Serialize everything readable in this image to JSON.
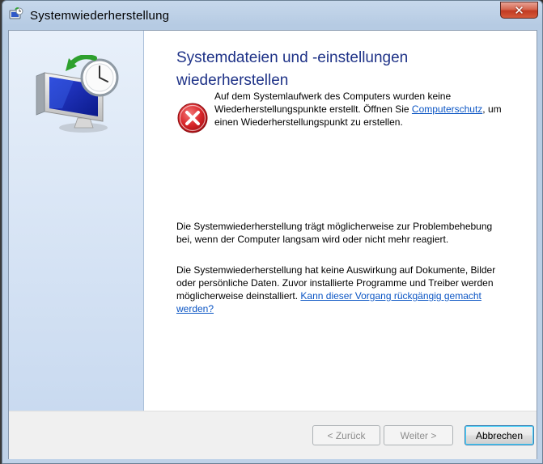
{
  "window": {
    "title": "Systemwiederherstellung"
  },
  "page": {
    "heading": "Systemdateien und -einstellungen wiederherstellen",
    "error_message_pre": "Auf dem Systemlaufwerk des Computers wurden keine Wiederherstellungspunkte erstellt. Öffnen Sie ",
    "error_link": "Computerschutz",
    "error_message_post": ", um einen Wiederherstellungspunkt zu erstellen.",
    "paragraph1": "Die Systemwiederherstellung trägt möglicherweise zur Problembehebung bei, wenn der Computer langsam wird oder nicht mehr reagiert.",
    "paragraph2_pre": "Die Systemwiederherstellung hat keine Auswirkung auf Dokumente, Bilder oder persönliche Daten. Zuvor installierte Programme und Treiber werden möglicherweise deinstalliert. ",
    "paragraph2_link": "Kann dieser Vorgang rückgängig gemacht werden?"
  },
  "buttons": {
    "back": "< Zurück",
    "next": "Weiter >",
    "cancel": "Abbrechen",
    "close_glyph": "✕"
  },
  "icons": {
    "title": "system-restore-icon",
    "sidebar": "system-restore-clock-monitor-icon",
    "error": "error-icon",
    "close": "close-icon"
  },
  "colors": {
    "heading": "#1e3287",
    "link": "#0b55c4",
    "error_red": "#d9262a",
    "close_button": "#c13b22"
  }
}
